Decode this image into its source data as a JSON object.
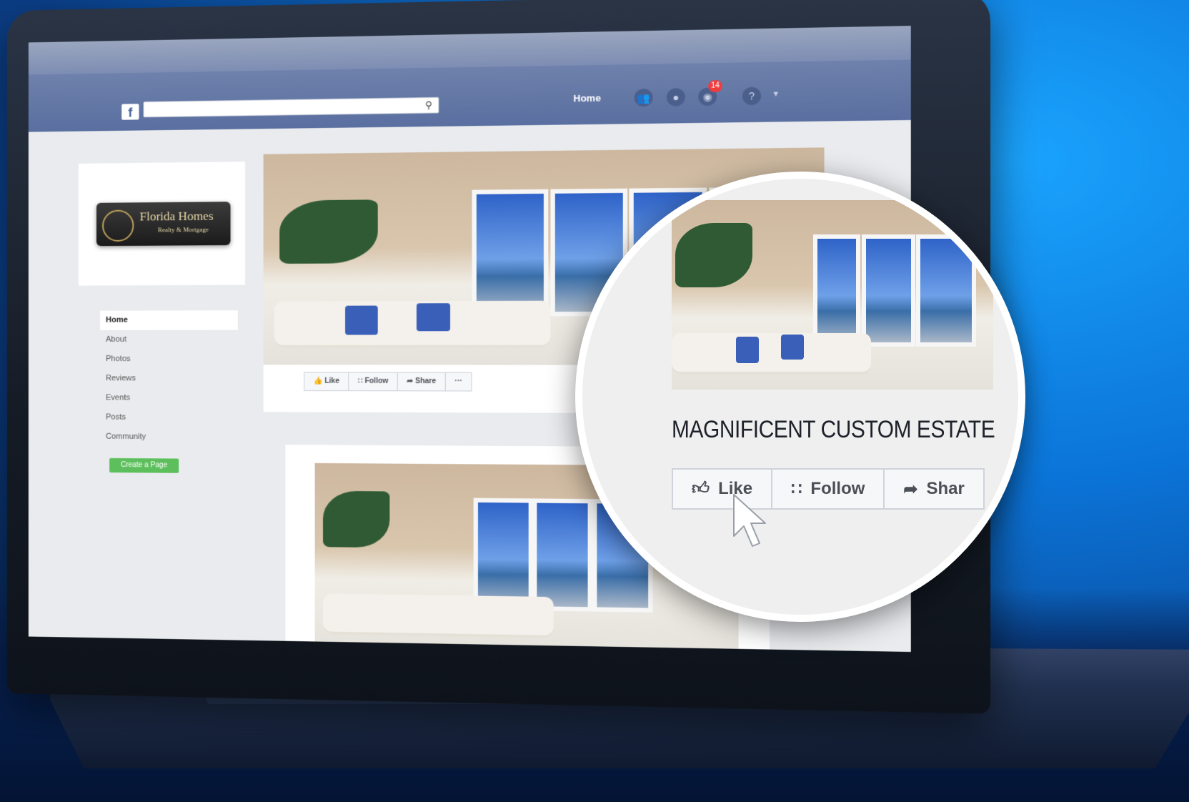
{
  "facebook_page": {
    "topbar": {
      "logo": "f",
      "search_placeholder": "",
      "search_icon": "search-icon",
      "nav_home": "Home",
      "notification_count": "14",
      "icons": [
        "friends-icon",
        "messenger-icon",
        "notifications-icon",
        "help-icon",
        "chevron-down-icon"
      ]
    },
    "profile": {
      "logo_line1": "Florida Homes",
      "logo_line2": "Realty & Mortgage"
    },
    "side_nav": {
      "items": [
        "Home",
        "About",
        "Photos",
        "Reviews",
        "Events",
        "Posts",
        "Community"
      ],
      "active": "Home",
      "create_page": "Create a Page"
    },
    "post_actions": {
      "like": "Like",
      "follow": "Follow",
      "share": "Share",
      "more": "···"
    }
  },
  "zoom": {
    "title": "MAGNIFICENT CUSTOM ESTATE",
    "actions": {
      "like": "Like",
      "follow": "Follow",
      "share": "Shar"
    }
  },
  "colors": {
    "fb_blue": "#5a6fa0",
    "background_blue": "#0b74d8",
    "create_green": "#5cbf5c",
    "pillow_blue": "#3a5fb8"
  }
}
